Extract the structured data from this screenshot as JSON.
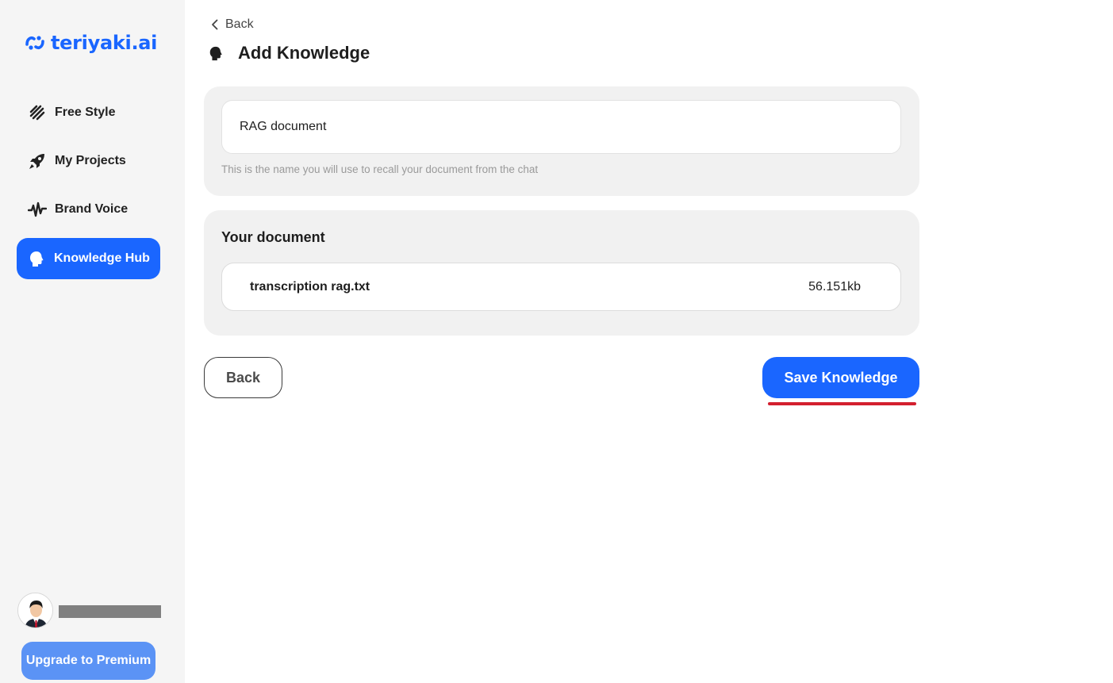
{
  "brand": {
    "name": "teriyaki.ai",
    "color": "#1a66ff"
  },
  "sidebar": {
    "items": [
      {
        "label": "Free Style",
        "icon": "free-style-icon",
        "active": false
      },
      {
        "label": "My Projects",
        "icon": "rocket-icon",
        "active": false
      },
      {
        "label": "Brand Voice",
        "icon": "waveform-icon",
        "active": false
      },
      {
        "label": "Knowledge Hub",
        "icon": "head-icon",
        "active": true
      }
    ],
    "upgrade_label": "Upgrade to Premium"
  },
  "header": {
    "back_label": "Back",
    "title": "Add Knowledge",
    "title_icon": "head-icon"
  },
  "name_card": {
    "input_value": "RAG document",
    "helper": "This is the name you will use to recall your document from the chat"
  },
  "document_card": {
    "heading": "Your document",
    "file": {
      "name": "transcription rag.txt",
      "size": "56.151kb"
    }
  },
  "actions": {
    "back_label": "Back",
    "save_label": "Save Knowledge"
  },
  "colors": {
    "accent": "#1a66ff",
    "upgrade": "#5b93f5",
    "sidebar_bg": "#f5f5f5",
    "card_bg": "#f1f1f1",
    "highlight_underline": "#d31f2f"
  }
}
